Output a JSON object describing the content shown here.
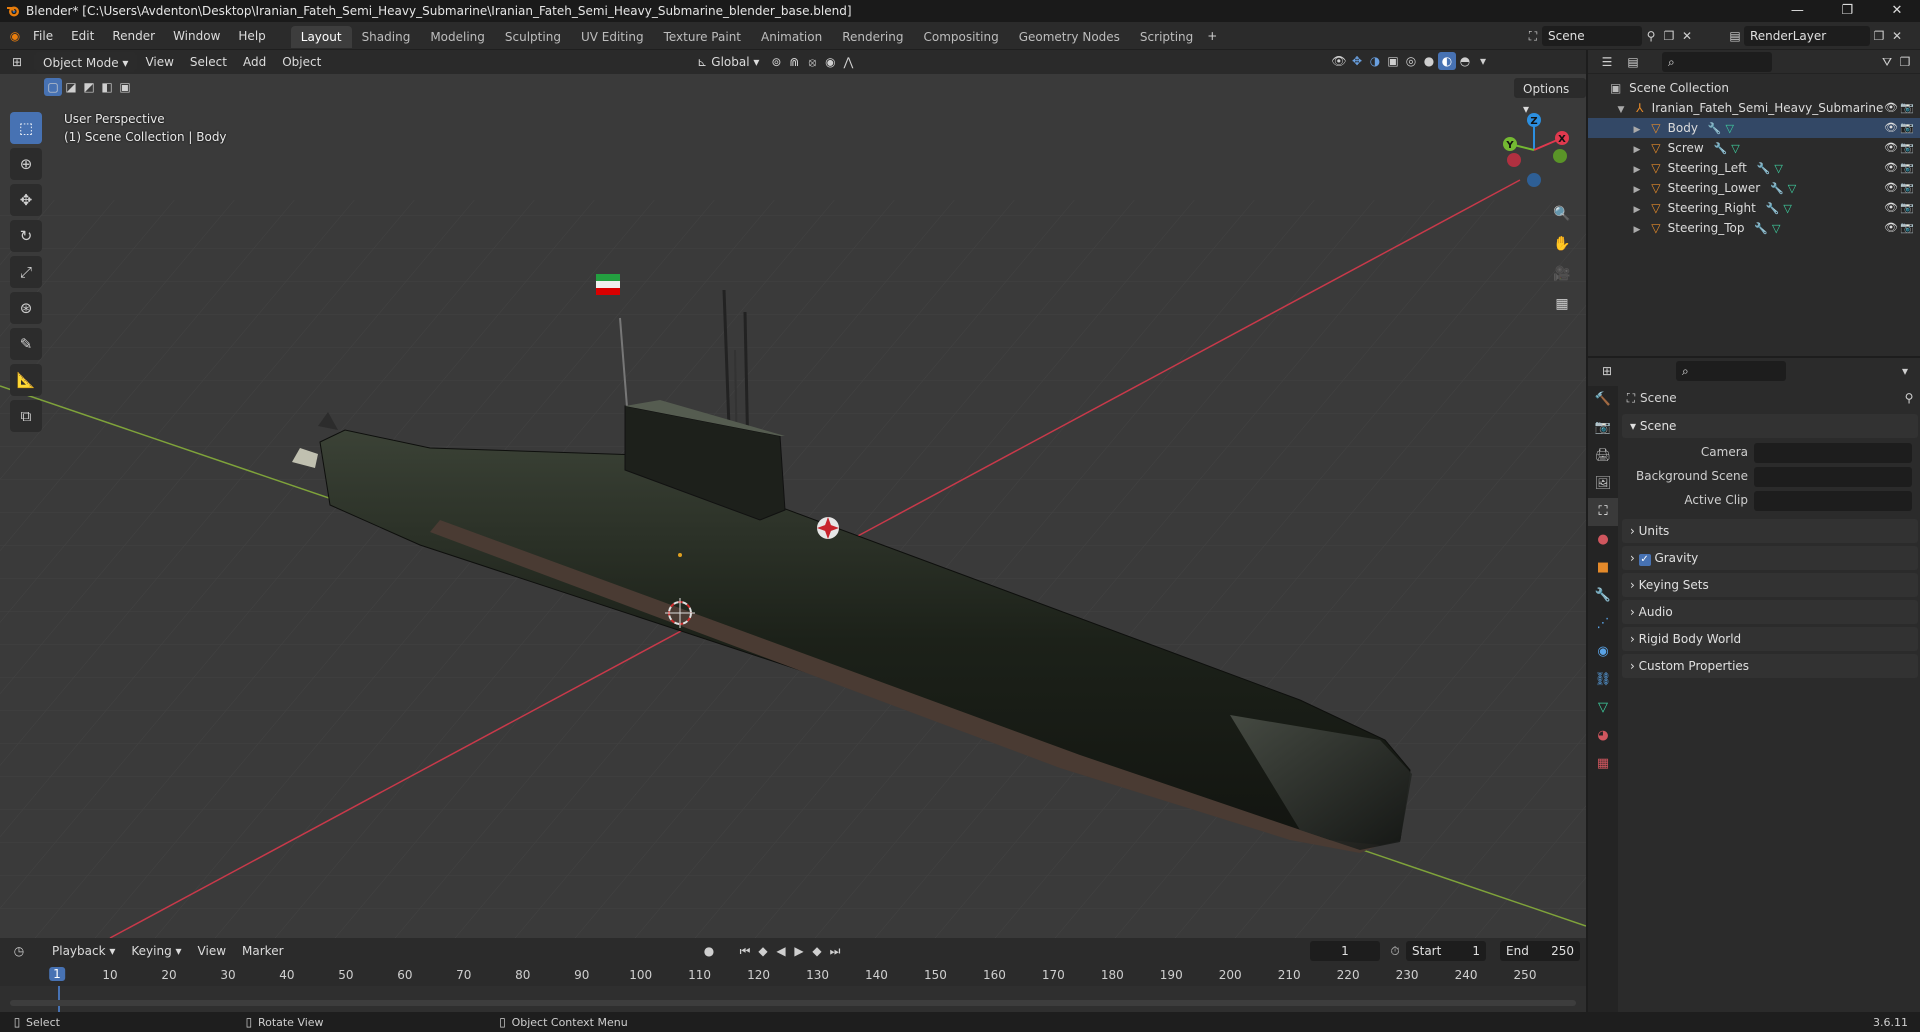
{
  "window": {
    "title": "Blender* [C:\\Users\\Avdenton\\Desktop\\Iranian_Fateh_Semi_Heavy_Submarine\\Iranian_Fateh_Semi_Heavy_Submarine_blender_base.blend]",
    "controls": [
      "—",
      "❐",
      "✕"
    ]
  },
  "menu": [
    "File",
    "Edit",
    "Render",
    "Window",
    "Help"
  ],
  "workspaces": [
    "Layout",
    "Shading",
    "Modeling",
    "Sculpting",
    "UV Editing",
    "Texture Paint",
    "Animation",
    "Rendering",
    "Compositing",
    "Geometry Nodes",
    "Scripting"
  ],
  "active_workspace": "Layout",
  "scene_field": "Scene",
  "renderlayer_field": "RenderLayer",
  "viewport": {
    "mode": "Object Mode",
    "menus": [
      "View",
      "Select",
      "Add",
      "Object"
    ],
    "transform_orientation": "Global",
    "options_label": "Options",
    "info_line1": "User Perspective",
    "info_line2": "(1) Scene Collection | Body",
    "gizmo_axes": [
      "X",
      "Y",
      "Z"
    ]
  },
  "outliner": {
    "root": "Scene Collection",
    "collection": "Iranian_Fateh_Semi_Heavy_Submarine",
    "objects": [
      "Body",
      "Screw",
      "Steering_Left",
      "Steering_Lower",
      "Steering_Right",
      "Steering_Top"
    ]
  },
  "properties": {
    "context": "Scene",
    "section": "Scene",
    "fields": [
      {
        "label": "Camera",
        "value": ""
      },
      {
        "label": "Background Scene",
        "value": ""
      },
      {
        "label": "Active Clip",
        "value": ""
      }
    ],
    "panels": [
      "Units",
      "Gravity",
      "Keying Sets",
      "Audio",
      "Rigid Body World",
      "Custom Properties"
    ],
    "gravity_checked": true
  },
  "timeline": {
    "menus": [
      "Playback",
      "Keying",
      "View",
      "Marker"
    ],
    "current_frame": "1",
    "start_label": "Start",
    "start": "1",
    "end_label": "End",
    "end": "250",
    "ticks": [
      "1",
      "10",
      "20",
      "30",
      "40",
      "50",
      "60",
      "70",
      "80",
      "90",
      "100",
      "110",
      "120",
      "130",
      "140",
      "150",
      "160",
      "170",
      "180",
      "190",
      "200",
      "210",
      "220",
      "230",
      "240",
      "250"
    ]
  },
  "status": {
    "select": "Select",
    "rotate": "Rotate View",
    "context_menu": "Object Context Menu",
    "version": "3.6.11"
  },
  "colors": {
    "accent": "#4772b3",
    "object_icon": "#e58a2a",
    "mesh_icon": "#3fd3a2",
    "modifier_icon": "#5aa3e6",
    "x_axis": "#e0394e",
    "y_axis": "#74b932",
    "z_axis": "#2c8fe0"
  }
}
